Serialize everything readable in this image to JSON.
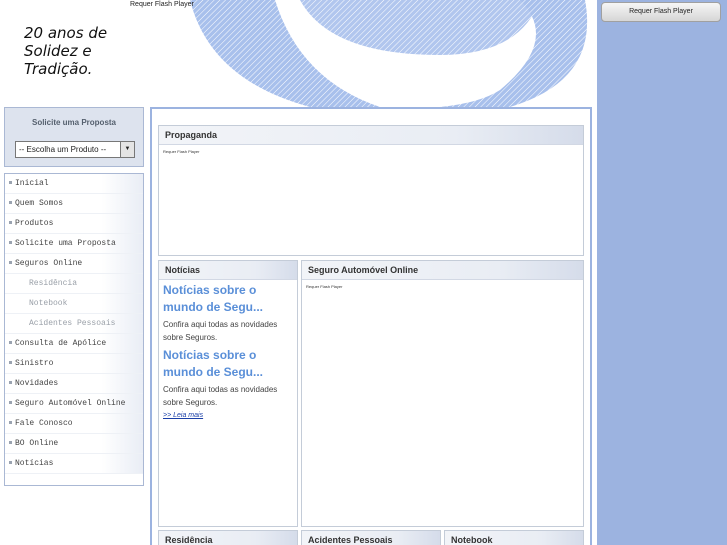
{
  "header": {
    "flash_label": "Requer Flash Player",
    "tagline": "20 anos de\nSolidez e\nTradição."
  },
  "right_sidebar": {
    "flash_button": "Requer Flash Player"
  },
  "proposal": {
    "title": "Solicite uma Proposta",
    "select_value": "-- Escolha um Produto --",
    "select_arrow": "▼"
  },
  "nav": {
    "items": [
      {
        "label": "Inicial"
      },
      {
        "label": "Quem Somos"
      },
      {
        "label": "Produtos"
      },
      {
        "label": "Solicite uma Proposta"
      },
      {
        "label": "Seguros Online"
      },
      {
        "label": "Residência"
      },
      {
        "label": "Notebook"
      },
      {
        "label": "Acidentes Pessoais"
      },
      {
        "label": "Consulta de Apólice"
      },
      {
        "label": "Sinistro"
      },
      {
        "label": "Novidades"
      },
      {
        "label": "Seguro Automóvel Online"
      },
      {
        "label": "Fale Conosco"
      },
      {
        "label": "BO Online"
      },
      {
        "label": "Notícias"
      }
    ]
  },
  "main": {
    "propaganda": {
      "title": "Propaganda",
      "flash_label": "Requer Flash Player"
    },
    "noticias": {
      "title": "Notícias",
      "items": [
        {
          "headline": "Notícias sobre o mundo de Segu...",
          "body": "Confira aqui todas as novidades sobre Seguros."
        },
        {
          "headline": "Notícias sobre o mundo de Segu...",
          "body": "Confira aqui todas as novidades sobre Seguros."
        }
      ],
      "read_more": ">> Leia mais"
    },
    "auto_online": {
      "title": "Seguro Automóvel Online",
      "flash_label": "Requer Flash Player"
    },
    "bottom_panels": {
      "residencia": "Residência",
      "acidentes": "Acidentes Pessoais",
      "notebook": "Notebook"
    }
  }
}
